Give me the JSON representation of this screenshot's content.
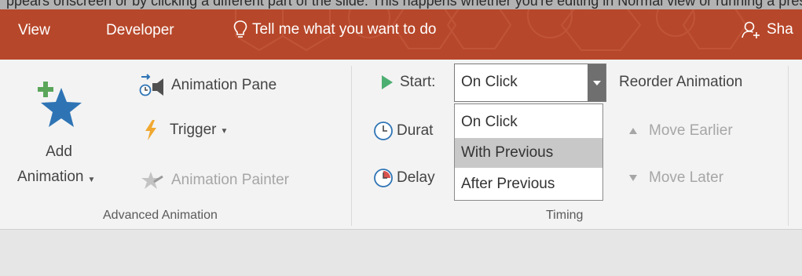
{
  "top_hint": "ppears onscreen or by clicking a different part of the slide. This happens whether you're editing in Normal view or running a presentation.",
  "tabs": [
    {
      "label": "View"
    },
    {
      "label": "Developer"
    }
  ],
  "tell_me": {
    "text": "Tell me what you want to do",
    "icon": "lightbulb-icon"
  },
  "share": {
    "label": "Sha",
    "icon": "person-add-icon"
  },
  "advanced_animation": {
    "group_label": "Advanced Animation",
    "add_animation": {
      "line1": "Add",
      "line2": "Animation"
    },
    "animation_pane": "Animation Pane",
    "trigger": "Trigger",
    "animation_painter": "Animation Painter"
  },
  "timing": {
    "group_label": "Timing",
    "start_label": "Start:",
    "start_value": "On Click",
    "duration_label": "Durat",
    "delay_label": "Delay",
    "reorder_label": "Reorder Animation",
    "move_earlier": "Move Earlier",
    "move_later": "Move Later",
    "options": [
      {
        "label": "On Click"
      },
      {
        "label": "With Previous"
      },
      {
        "label": "After Previous"
      }
    ]
  },
  "colors": {
    "tab_bar": "#b7472a",
    "ribbon": "#f3f3f3",
    "accent_blue": "#2e74b5",
    "selection": "#c8c8c8"
  }
}
